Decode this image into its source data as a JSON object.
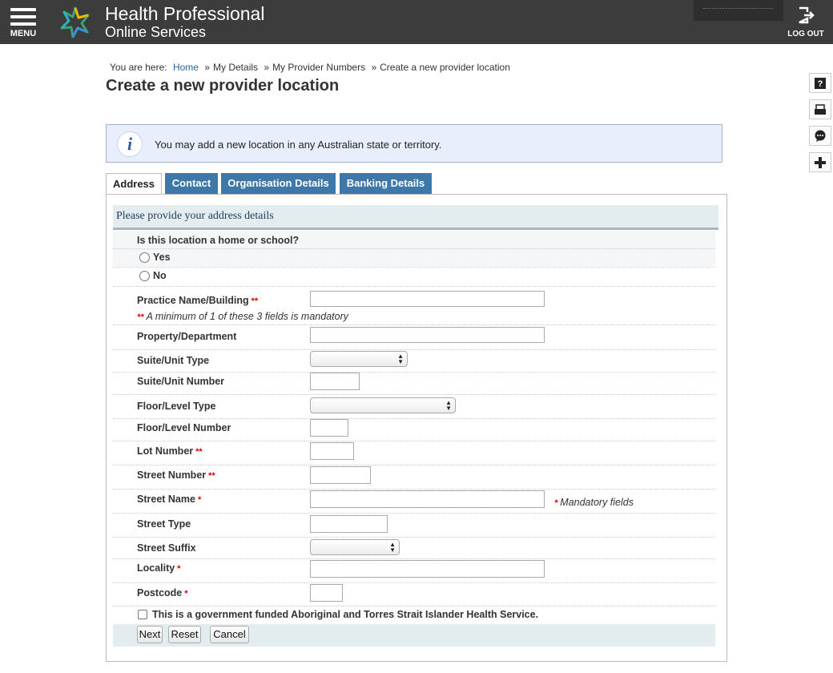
{
  "header": {
    "menu_label": "MENU",
    "brand_line1": "Health Professional",
    "brand_line2": "Online Services",
    "logout_label": "LOG OUT"
  },
  "breadcrumb": {
    "prefix": "You are here:",
    "items": [
      "Home",
      "My Details",
      "My Provider Numbers",
      "Create a new provider location"
    ]
  },
  "page_title": "Create a new provider location",
  "info_message": "You may add a new location in any Australian state or territory.",
  "tabs": [
    {
      "label": "Address",
      "active": true
    },
    {
      "label": "Contact",
      "active": false
    },
    {
      "label": "Organisation Details",
      "active": false
    },
    {
      "label": "Banking Details",
      "active": false
    }
  ],
  "form": {
    "section_title": "Please provide your address details",
    "question_home_school": "Is this location a home or school?",
    "radio_yes": "Yes",
    "radio_no": "No",
    "practice_name_label": "Practice Name/Building",
    "min_fields_note": "A minimum of 1 of these 3 fields is mandatory",
    "property_label": "Property/Department",
    "suite_type_label": "Suite/Unit Type",
    "suite_number_label": "Suite/Unit Number",
    "floor_type_label": "Floor/Level Type",
    "floor_number_label": "Floor/Level Number",
    "lot_number_label": "Lot Number",
    "street_number_label": "Street Number",
    "street_name_label": "Street Name",
    "mandatory_fields_note": "Mandatory fields",
    "street_type_label": "Street Type",
    "street_suffix_label": "Street Suffix",
    "locality_label": "Locality",
    "postcode_label": "Postcode",
    "aboriginal_checkbox_label": "This is a government funded Aboriginal and Torres Strait Islander Health Service.",
    "req_double": "**",
    "req_single": "*"
  },
  "buttons": {
    "next": "Next",
    "reset": "Reset",
    "cancel": "Cancel"
  },
  "colors": {
    "header_bg": "#3c3c3c",
    "tab_inactive": "#3e78a8",
    "info_bg": "#e8eefb",
    "section_bg": "#e3ecee",
    "required": "#dd0000"
  }
}
